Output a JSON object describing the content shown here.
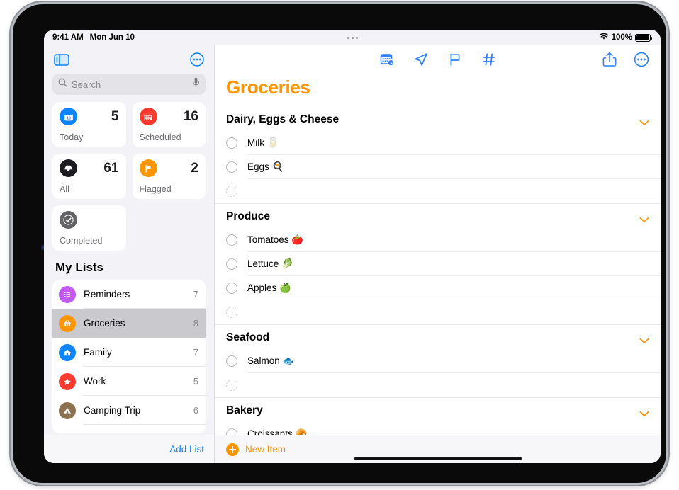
{
  "status_bar": {
    "time": "9:41 AM",
    "date": "Mon Jun 10",
    "battery_percent": "100%",
    "wifi_icon": "wifi-icon",
    "battery_icon": "battery-icon",
    "multitask_icon": "multitask-dots-icon"
  },
  "sidebar": {
    "toggle_icon": "sidebar-toggle-icon",
    "more_icon": "circle-ellipsis-icon",
    "search": {
      "placeholder": "Search",
      "search_icon": "search-icon",
      "mic_icon": "microphone-icon"
    },
    "smart_lists": [
      {
        "label": "Today",
        "count": "5",
        "icon": "calendar-day-icon",
        "color": "#0a84ff"
      },
      {
        "label": "Scheduled",
        "count": "16",
        "icon": "calendar-icon",
        "color": "#ff3b30"
      },
      {
        "label": "All",
        "count": "61",
        "icon": "inbox-tray-icon",
        "color": "#1c1c1e"
      },
      {
        "label": "Flagged",
        "count": "2",
        "icon": "flag-icon",
        "color": "#ff9500"
      },
      {
        "label": "Completed",
        "count": "",
        "icon": "checkmark-circle-icon",
        "color": "#636366"
      }
    ],
    "my_lists_title": "My Lists",
    "lists": [
      {
        "name": "Reminders",
        "count": "7",
        "icon": "bullet-list-icon",
        "color": "#bf5af2",
        "selected": false
      },
      {
        "name": "Groceries",
        "count": "8",
        "icon": "basket-icon",
        "color": "#ff9500",
        "selected": true
      },
      {
        "name": "Family",
        "count": "7",
        "icon": "house-icon",
        "color": "#0a84ff",
        "selected": false
      },
      {
        "name": "Work",
        "count": "5",
        "icon": "star-icon",
        "color": "#ff3b30",
        "selected": false
      },
      {
        "name": "Camping Trip",
        "count": "6",
        "icon": "tent-icon",
        "color": "#8d7251",
        "selected": false
      }
    ],
    "add_list_label": "Add List"
  },
  "detail": {
    "title": "Groceries",
    "title_color": "#ff9500",
    "toolbar_center_icons": [
      "calendar-clock-icon",
      "location-arrow-icon",
      "flag-outline-icon",
      "hashtag-icon"
    ],
    "toolbar_right_icons": [
      "share-icon",
      "circle-ellipsis-icon"
    ],
    "sections": [
      {
        "title": "Dairy, Eggs & Cheese",
        "collapse_icon": "chevron-down-icon",
        "items": [
          {
            "text": "Milk 🥛",
            "placeholder": false
          },
          {
            "text": "Eggs 🍳",
            "placeholder": false
          },
          {
            "text": "",
            "placeholder": true
          }
        ]
      },
      {
        "title": "Produce",
        "collapse_icon": "chevron-down-icon",
        "items": [
          {
            "text": "Tomatoes 🍅",
            "placeholder": false
          },
          {
            "text": "Lettuce 🥬",
            "placeholder": false
          },
          {
            "text": "Apples 🍏",
            "placeholder": false
          },
          {
            "text": "",
            "placeholder": true
          }
        ]
      },
      {
        "title": "Seafood",
        "collapse_icon": "chevron-down-icon",
        "items": [
          {
            "text": "Salmon 🐟",
            "placeholder": false
          },
          {
            "text": "",
            "placeholder": true
          }
        ]
      },
      {
        "title": "Bakery",
        "collapse_icon": "chevron-down-icon",
        "items": [
          {
            "text": "Croissants 🥐",
            "placeholder": false
          }
        ]
      }
    ],
    "new_item_label": "New Item",
    "new_item_icon": "plus-circle-icon"
  }
}
